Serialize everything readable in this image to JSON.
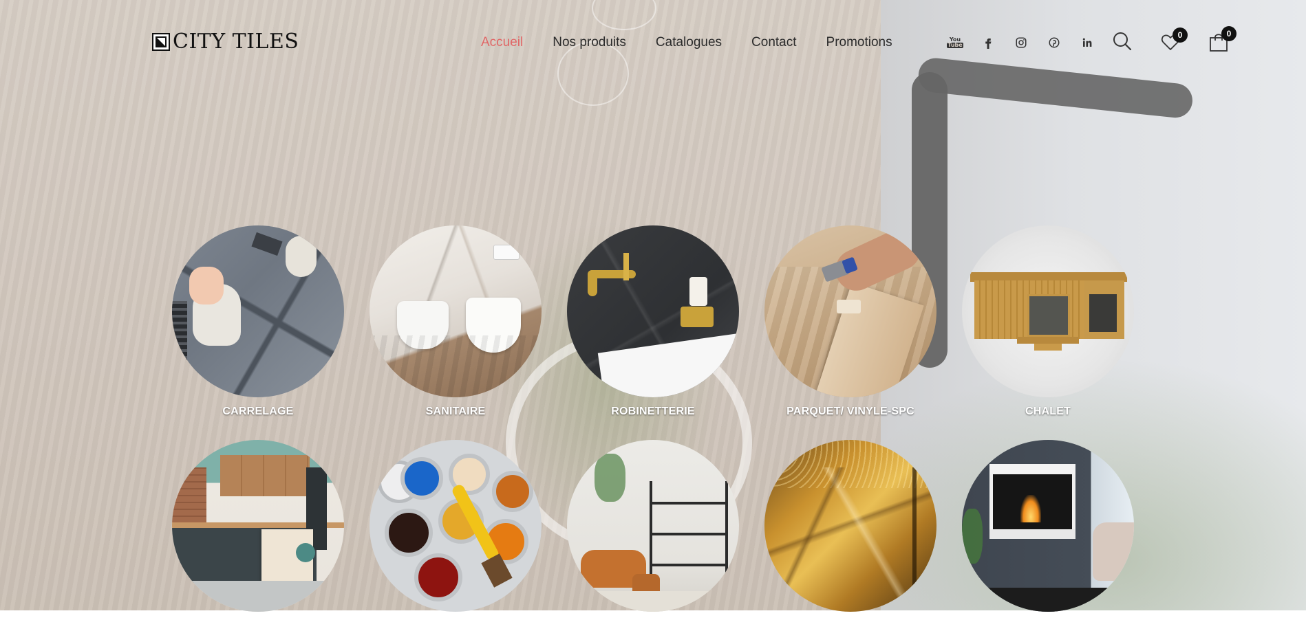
{
  "brand": {
    "name": "CITY TILES"
  },
  "nav": {
    "items": [
      {
        "label": "Accueil",
        "active": true
      },
      {
        "label": "Nos produits",
        "active": false
      },
      {
        "label": "Catalogues",
        "active": false
      },
      {
        "label": "Contact",
        "active": false
      },
      {
        "label": "Promotions",
        "active": false
      }
    ]
  },
  "socials": {
    "youtube_top": "You",
    "youtube_bottom": "Tube",
    "icons": [
      "youtube-icon",
      "facebook-icon",
      "instagram-icon",
      "pinterest-icon",
      "linkedin-icon"
    ]
  },
  "tools": {
    "wishlist_count": "0",
    "cart_count": "0"
  },
  "categories": [
    {
      "label": "CARRELAGE"
    },
    {
      "label": "SANITAIRE"
    },
    {
      "label": "ROBINETTERIE"
    },
    {
      "label": "PARQUET/ VINYLE-SPC"
    },
    {
      "label": "CHALET"
    },
    {
      "label": ""
    },
    {
      "label": ""
    },
    {
      "label": ""
    },
    {
      "label": ""
    },
    {
      "label": ""
    }
  ],
  "colors": {
    "accent": "#e06666",
    "text": "#2b2b2b",
    "badge": "#111111"
  }
}
